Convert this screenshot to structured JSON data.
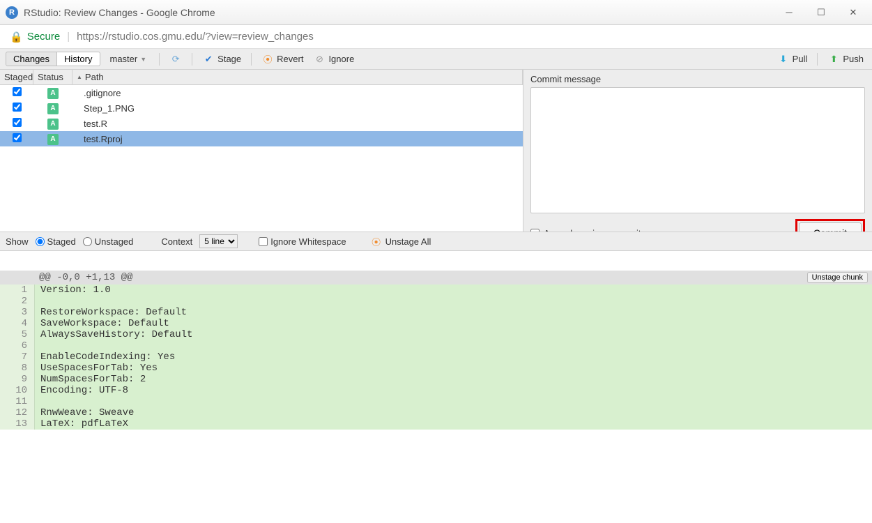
{
  "window": {
    "title": "RStudio: Review Changes - Google Chrome",
    "favicon_letter": "R"
  },
  "url": {
    "secure_label": "Secure",
    "text": "https://rstudio.cos.gmu.edu/?view=review_changes"
  },
  "toolbar": {
    "changes": "Changes",
    "history": "History",
    "branch": "master",
    "stage": "Stage",
    "revert": "Revert",
    "ignore": "Ignore",
    "pull": "Pull",
    "push": "Push"
  },
  "columns": {
    "staged": "Staged",
    "status": "Status",
    "path": "Path"
  },
  "files": [
    {
      "staged": true,
      "status": "A",
      "path": ".gitignore",
      "selected": false
    },
    {
      "staged": true,
      "status": "A",
      "path": "Step_1.PNG",
      "selected": false
    },
    {
      "staged": true,
      "status": "A",
      "path": "test.R",
      "selected": false
    },
    {
      "staged": true,
      "status": "A",
      "path": "test.Rproj",
      "selected": true
    }
  ],
  "commit": {
    "label": "Commit message",
    "value": "",
    "amend_label": "Amend previous commit",
    "button": "Commit"
  },
  "diffbar": {
    "show": "Show",
    "staged": "Staged",
    "unstaged": "Unstaged",
    "context": "Context",
    "context_value": "5 line",
    "ignore_ws": "Ignore Whitespace",
    "unstage_all": "Unstage All"
  },
  "diff": {
    "hunk": "@@ -0,0 +1,13 @@",
    "unstage_chunk": "Unstage chunk",
    "lines": [
      {
        "n": 1,
        "text": "Version: 1.0"
      },
      {
        "n": 2,
        "text": ""
      },
      {
        "n": 3,
        "text": "RestoreWorkspace: Default"
      },
      {
        "n": 4,
        "text": "SaveWorkspace: Default"
      },
      {
        "n": 5,
        "text": "AlwaysSaveHistory: Default"
      },
      {
        "n": 6,
        "text": ""
      },
      {
        "n": 7,
        "text": "EnableCodeIndexing: Yes"
      },
      {
        "n": 8,
        "text": "UseSpacesForTab: Yes"
      },
      {
        "n": 9,
        "text": "NumSpacesForTab: 2"
      },
      {
        "n": 10,
        "text": "Encoding: UTF-8"
      },
      {
        "n": 11,
        "text": ""
      },
      {
        "n": 12,
        "text": "RnwWeave: Sweave"
      },
      {
        "n": 13,
        "text": "LaTeX: pdfLaTeX"
      }
    ]
  }
}
